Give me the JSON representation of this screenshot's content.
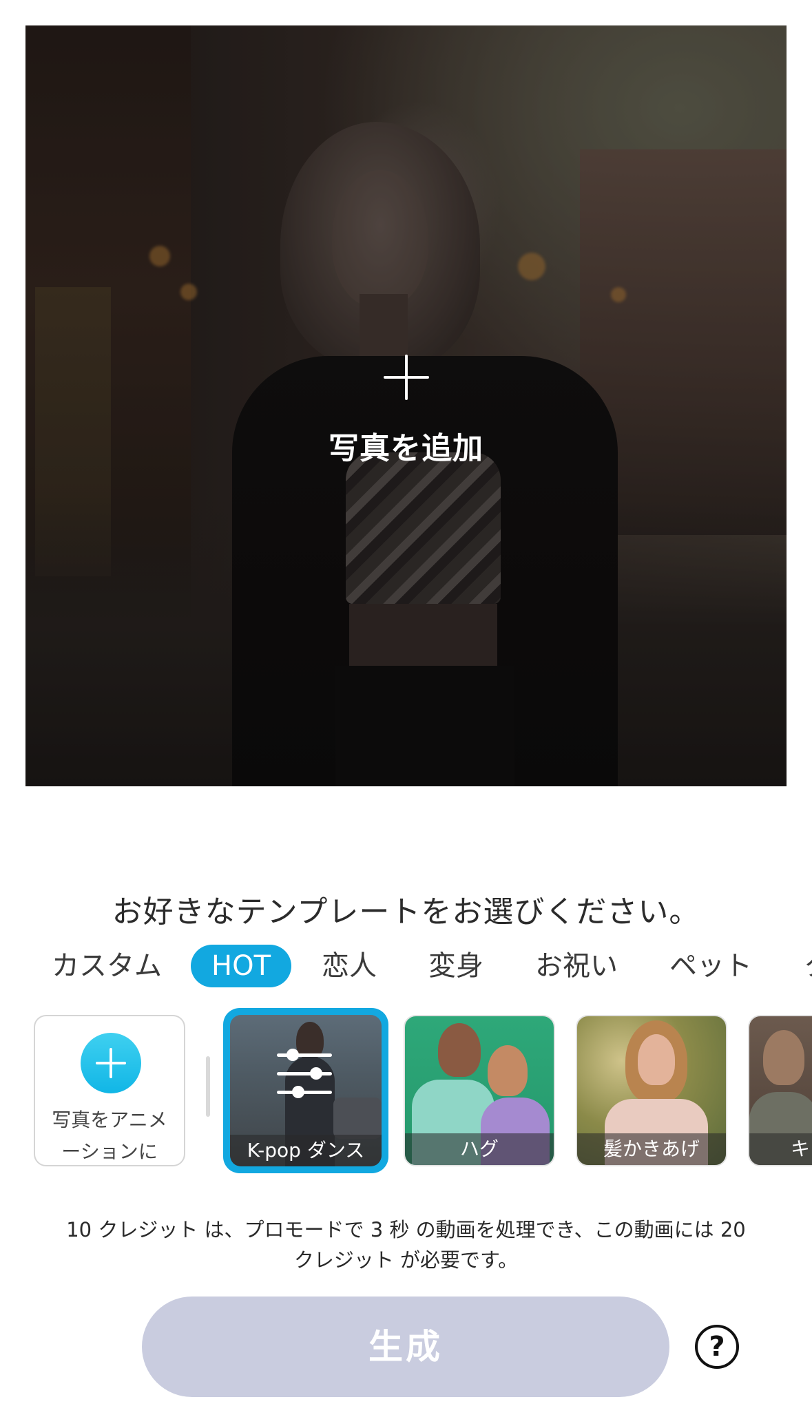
{
  "photo": {
    "add_label": "写真を追加"
  },
  "templates_section": {
    "prompt": "お好きなテンプレートをお選びください。",
    "tabs": [
      "カスタム",
      "HOT",
      "恋人",
      "変身",
      "お祝い",
      "ペット",
      "ク"
    ],
    "active_tab": "HOT",
    "animate_card_line1": "写真をアニメ",
    "animate_card_line2": "ーションに",
    "items": [
      {
        "label": "K-pop ダンス",
        "selected": true
      },
      {
        "label": "ハグ",
        "selected": false
      },
      {
        "label": "髪かきあげ",
        "selected": false
      },
      {
        "label": "キ",
        "selected": false
      }
    ]
  },
  "footer": {
    "credit_line1": "10 クレジット は、プロモードで 3 秒 の動画を処理でき、この動画には 20",
    "credit_line2": "クレジット が必要です。",
    "generate_label": "生成",
    "help_label": "?"
  },
  "colors": {
    "accent": "#12a8e0",
    "generate_disabled": "#c9ccdf"
  }
}
